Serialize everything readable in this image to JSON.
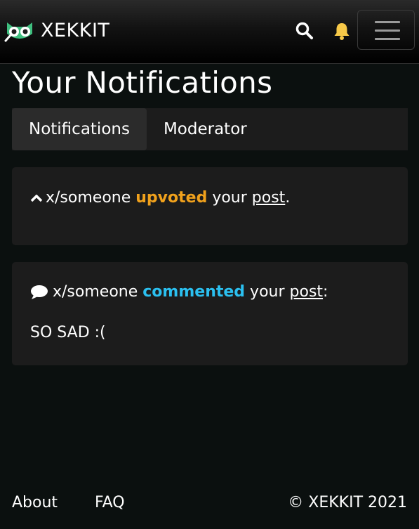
{
  "navbar": {
    "brand": "XEKKIT",
    "icons": {
      "logo": "owl-logo-icon",
      "search": "search-icon",
      "bell": "bell-icon",
      "menu": "hamburger-menu-icon"
    },
    "colors": {
      "bell": "#f7c948"
    }
  },
  "page": {
    "title": "Your Notifications",
    "tabs": [
      {
        "label": "Notifications",
        "active": true
      },
      {
        "label": "Moderator",
        "active": false
      }
    ]
  },
  "notifications": [
    {
      "icon": "chevron-up-icon",
      "user": "x/someone",
      "action": "upvoted",
      "your": "your",
      "target": "post",
      "end": ".",
      "color": "#f0a11c"
    },
    {
      "icon": "speech-bubble-icon",
      "user": "x/someone",
      "action": "commented",
      "your": "your",
      "target": "post",
      "end": ":",
      "comment": "SO SAD :(",
      "color": "#2bc0f0"
    }
  ],
  "footer": {
    "about": "About",
    "faq": "FAQ",
    "copyright": "© XEKKIT 2021"
  }
}
